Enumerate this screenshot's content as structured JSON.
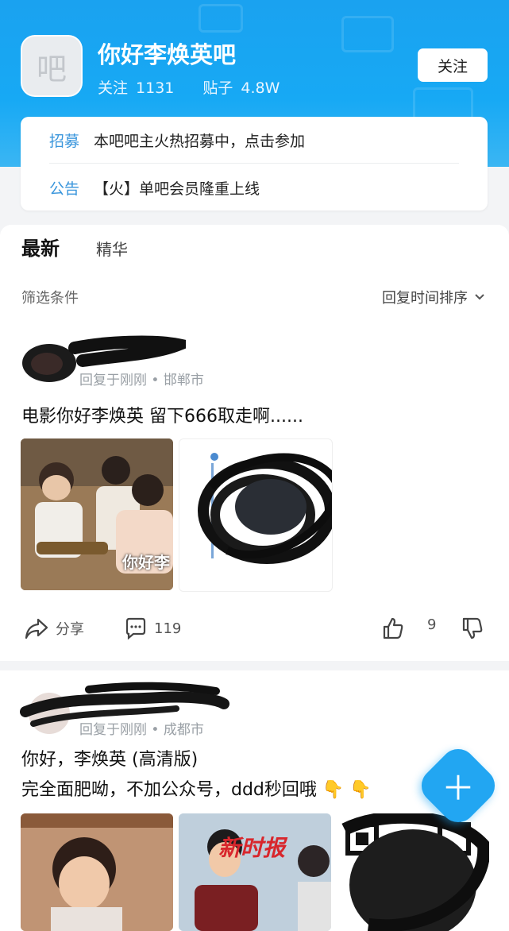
{
  "header": {
    "avatar_glyph": "吧",
    "title": "你好李焕英吧",
    "follow_label": "关注",
    "follow_count": "1131",
    "posts_label": "贴子",
    "posts_count": "4.8W",
    "follow_button": "关注"
  },
  "notices": [
    {
      "tag": "招募",
      "text": "本吧吧主火热招募中，点击参加"
    },
    {
      "tag": "公告",
      "text": "【火】单吧会员隆重上线"
    }
  ],
  "tabs": {
    "active": "最新",
    "other": "精华"
  },
  "filter": {
    "label": "筛选条件",
    "sort": "回复时间排序"
  },
  "posts": [
    {
      "meta": "回复于刚刚 • 邯郸市",
      "title": "电影你好李焕英 留下666取走啊......",
      "poster_text": "你好李",
      "share": "分享",
      "comments": "119",
      "likes": "9"
    },
    {
      "meta": "回复于刚刚 • 成都市",
      "line1": "你好，李焕英 (高清版)",
      "line2": "完全面肥呦，不加公众号，ddd秒回哦 👇 👇",
      "stamp": "新时报"
    }
  ],
  "colors": {
    "brand": "#1aa2f0",
    "accent_tag": "#3a96dc",
    "fab": "#22a6f2"
  }
}
